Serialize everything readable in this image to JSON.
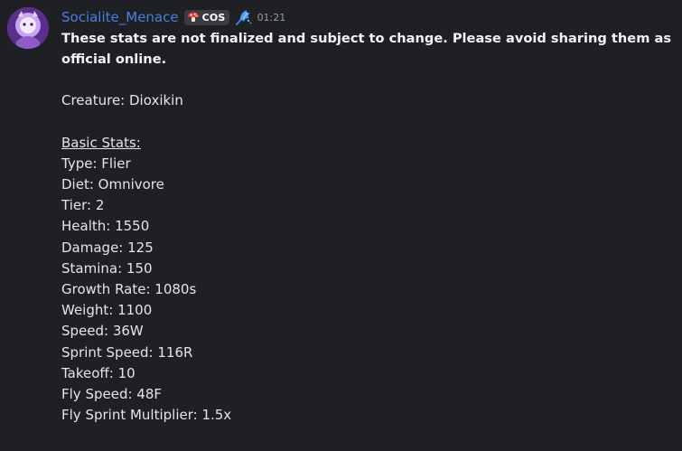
{
  "message": {
    "author": {
      "username": "Socialite_Menace",
      "role_tag": "COS",
      "role_icon": "mushroom-icon",
      "badge_icon": "feather-dragon-icon"
    },
    "timestamp": "01:21",
    "warning": "These stats are not finalized and subject to change. Please avoid sharing them as official online.",
    "creature_line": "Creature: Dioxikin",
    "basic_stats_heading": "Basic Stats:",
    "stats": [
      "Type: Flier",
      "Diet: Omnivore",
      "Tier: 2",
      "Health: 1550",
      "Damage: 125",
      "Stamina: 150",
      "Growth Rate: 1080s",
      "Weight: 1100",
      "Speed: 36W",
      "Sprint Speed: 116R",
      "Takeoff: 10",
      "Fly Speed: 48F",
      "Fly Sprint Multiplier: 1.5x"
    ]
  },
  "colors": {
    "background": "#1f2023",
    "username": "#4a7fe0",
    "text": "#e3e5e8",
    "timestamp": "#949ba4",
    "tag_bg": "#3a3c42"
  }
}
